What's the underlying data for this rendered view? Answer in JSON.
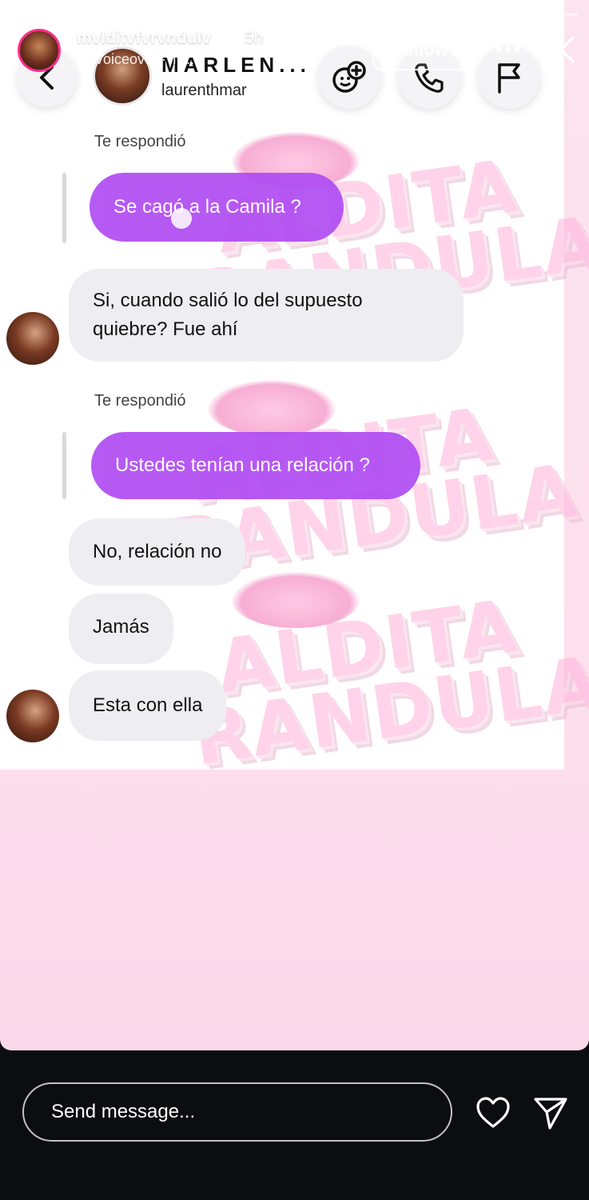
{
  "story": {
    "username": "mvlditvfvrvndulv",
    "time": "5h",
    "subtitle": "Voiceover · Tr...",
    "follow_label": "Follow",
    "more_label": "•••",
    "progress_segments": 22,
    "progress_done": 12
  },
  "dm_header": {
    "name": "MARLEN...",
    "handle": "laurenthmar"
  },
  "watermark": {
    "line1": "ALDITA",
    "line2": "RANDULA"
  },
  "chat": {
    "reply1_label": "Te respondió",
    "reply1_text": "Se cagó a la Camila ?",
    "msg1": "Si, cuando salió lo del supuesto quiebre? Fue ahí",
    "reply2_label": "Te respondió",
    "reply2_text": "Ustedes tenían una relación ?",
    "msg2": "No, relación no",
    "msg3": "Jamás",
    "msg4": "Esta con ella"
  },
  "footer": {
    "send_placeholder": "Send message..."
  },
  "colors": {
    "bubble_purple": "#b04cf3",
    "bubble_gray": "#eeeef2",
    "story_ring": "#ff2e8c",
    "background_pink": "#fde1ee"
  }
}
